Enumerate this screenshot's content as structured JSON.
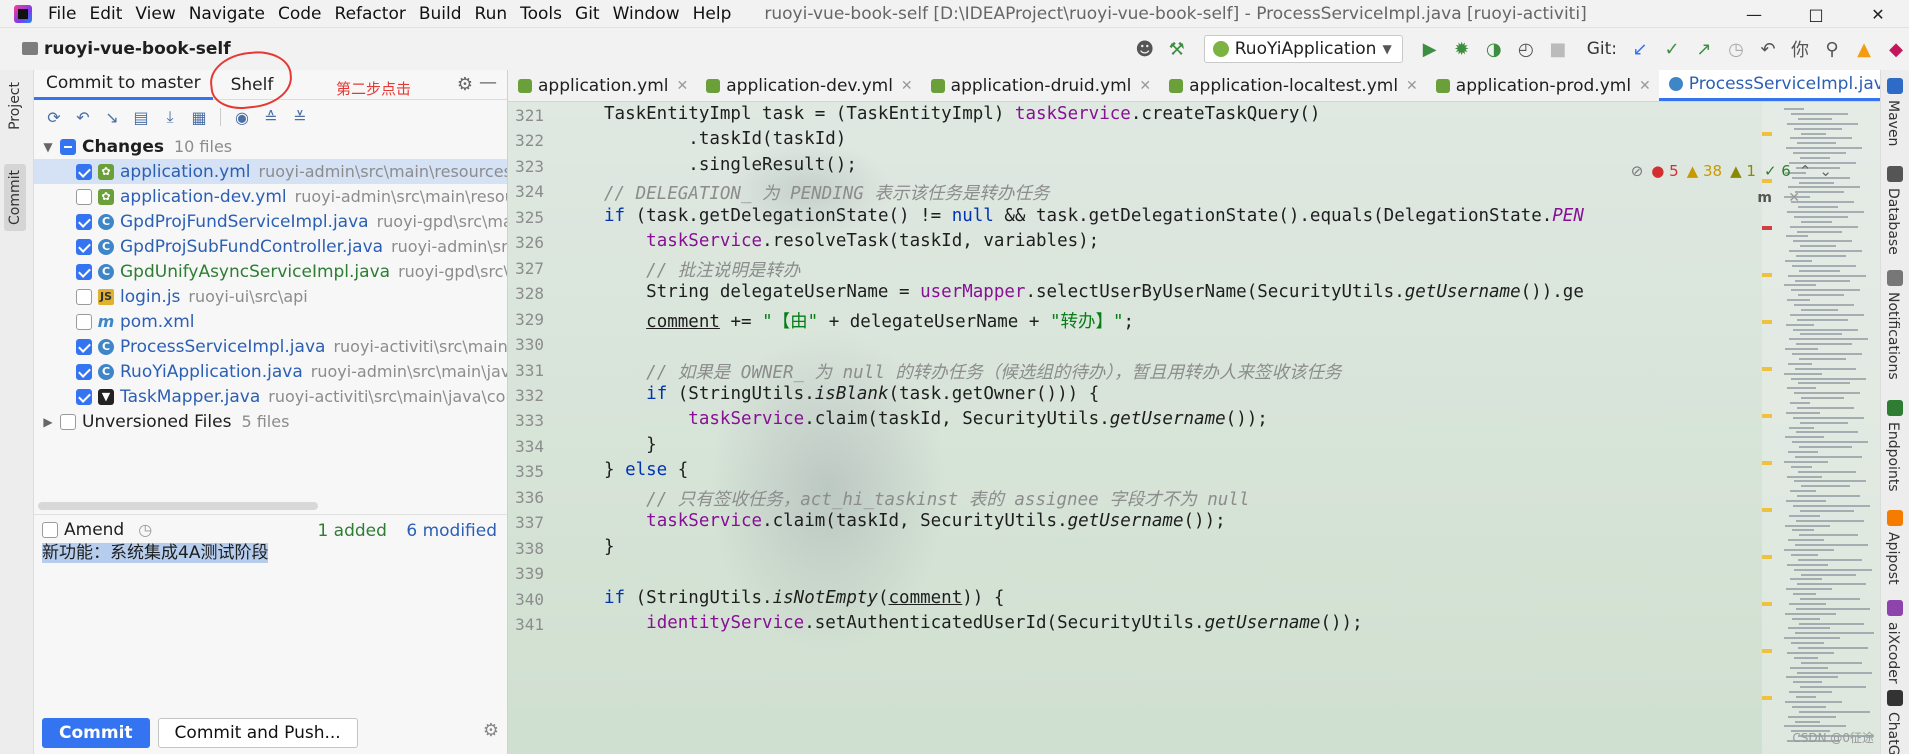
{
  "menu": {
    "items": [
      "File",
      "Edit",
      "View",
      "Navigate",
      "Code",
      "Refactor",
      "Build",
      "Run",
      "Tools",
      "Git",
      "Window",
      "Help"
    ],
    "window_title": "ruoyi-vue-book-self [D:\\IDEAProject\\ruoyi-vue-book-self] - ProcessServiceImpl.java [ruoyi-activiti]"
  },
  "toolbar": {
    "project_name": "ruoyi-vue-book-self",
    "run_config": "RuoYiApplication",
    "git_label": "Git:"
  },
  "left_strip": {
    "project_tab": "Project",
    "commit_tab": "Commit"
  },
  "commit_panel": {
    "tabs": {
      "commit": "Commit to master",
      "shelf": "Shelf"
    },
    "annotation_text": "第二步点击",
    "changes_group": {
      "label": "Changes",
      "count": "10 files"
    },
    "files": [
      {
        "name": "application.yml",
        "path": "ruoyi-admin\\src\\main\\resources",
        "type": "yml",
        "status": "mod",
        "checked": true,
        "selected": true
      },
      {
        "name": "application-dev.yml",
        "path": "ruoyi-admin\\src\\main\\resou",
        "type": "yml",
        "status": "mod",
        "checked": false,
        "selected": false
      },
      {
        "name": "GpdProjFundServiceImpl.java",
        "path": "ruoyi-gpd\\src\\main",
        "type": "java",
        "status": "mod",
        "checked": true,
        "selected": false
      },
      {
        "name": "GpdProjSubFundController.java",
        "path": "ruoyi-admin\\src\\",
        "type": "java",
        "status": "mod",
        "checked": true,
        "selected": false
      },
      {
        "name": "GpdUnifyAsyncServiceImpl.java",
        "path": "ruoyi-gpd\\src\\ma",
        "type": "java",
        "status": "add",
        "checked": true,
        "selected": false
      },
      {
        "name": "login.js",
        "path": "ruoyi-ui\\src\\api",
        "type": "js",
        "status": "mod",
        "checked": false,
        "selected": false
      },
      {
        "name": "pom.xml",
        "path": "",
        "type": "xml",
        "status": "mod",
        "checked": false,
        "selected": false
      },
      {
        "name": "ProcessServiceImpl.java",
        "path": "ruoyi-activiti\\src\\main\\ja",
        "type": "java",
        "status": "mod",
        "checked": true,
        "selected": false
      },
      {
        "name": "RuoYiApplication.java",
        "path": "ruoyi-admin\\src\\main\\java",
        "type": "java",
        "status": "mod",
        "checked": true,
        "selected": false
      },
      {
        "name": "TaskMapper.java",
        "path": "ruoyi-activiti\\src\\main\\java\\con",
        "type": "mapper",
        "status": "mod",
        "checked": true,
        "selected": false
      }
    ],
    "unversioned_group": {
      "label": "Unversioned Files",
      "count": "5 files"
    },
    "amend_label": "Amend",
    "stats": {
      "added": "1 added",
      "modified": "6 modified"
    },
    "commit_message": "新功能：系统集成4A测试阶段",
    "buttons": {
      "commit": "Commit",
      "commit_push": "Commit and Push..."
    }
  },
  "editor": {
    "tabs": [
      {
        "label": "application.yml",
        "type": "yml",
        "active": false
      },
      {
        "label": "application-dev.yml",
        "type": "yml",
        "active": false
      },
      {
        "label": "application-druid.yml",
        "type": "yml",
        "active": false
      },
      {
        "label": "application-localtest.yml",
        "type": "yml",
        "active": false
      },
      {
        "label": "application-prod.yml",
        "type": "yml",
        "active": false
      },
      {
        "label": "ProcessServiceImpl.java",
        "type": "java",
        "active": true
      }
    ],
    "inspections": {
      "errors": "5",
      "warnings": "38",
      "weak": "1",
      "ok": "6"
    },
    "ai_badge": "m",
    "line_numbers": [
      "321",
      "322",
      "323",
      "324",
      "325",
      "326",
      "327",
      "328",
      "329",
      "330",
      "331",
      "332",
      "333",
      "334",
      "335",
      "336",
      "337",
      "338",
      "339",
      "340",
      "341"
    ],
    "code_lines": [
      [
        [
          "",
          "TaskEntityImpl task = (TaskEntityImpl) "
        ],
        [
          "fld",
          "taskService"
        ],
        [
          "",
          ".createTaskQuery()"
        ]
      ],
      [
        [
          "",
          "        .taskId(taskId)"
        ]
      ],
      [
        [
          "",
          "        .singleResult();"
        ]
      ],
      [
        [
          "cm",
          "// DELEGATION_ 为 PENDING 表示该任务是转办任务"
        ]
      ],
      [
        [
          "kw",
          "if"
        ],
        [
          "",
          " (task.getDelegationState() != "
        ],
        [
          "kw",
          "null"
        ],
        [
          "",
          " && task.getDelegationState().equals(DelegationState."
        ],
        [
          "fld it",
          "PEN"
        ]
      ],
      [
        [
          "",
          "    "
        ],
        [
          "fld",
          "taskService"
        ],
        [
          "",
          ".resolveTask(taskId, variables);"
        ]
      ],
      [
        [
          "",
          "    "
        ],
        [
          "cm",
          "// 批注说明是转办"
        ]
      ],
      [
        [
          "",
          "    String delegateUserName = "
        ],
        [
          "fld",
          "userMapper"
        ],
        [
          "",
          ".selectUserByUserName(SecurityUtils."
        ],
        [
          "it",
          "getUsername"
        ],
        [
          "",
          "()).ge"
        ]
      ],
      [
        [
          "",
          "    "
        ],
        [
          "ul",
          "comment"
        ],
        [
          "",
          " += "
        ],
        [
          "str",
          "\"【由\""
        ],
        [
          "",
          " + delegateUserName + "
        ],
        [
          "str",
          "\"转办】\""
        ],
        [
          "",
          ";"
        ]
      ],
      [
        [
          "",
          ""
        ]
      ],
      [
        [
          "",
          "    "
        ],
        [
          "cm",
          "// 如果是 OWNER_ 为 null 的转办任务（候选组的待办），暂且用转办人来签收该任务"
        ]
      ],
      [
        [
          "",
          "    "
        ],
        [
          "kw",
          "if"
        ],
        [
          "",
          " (StringUtils."
        ],
        [
          "it",
          "isBlank"
        ],
        [
          "",
          "(task.getOwner())) {"
        ]
      ],
      [
        [
          "",
          "        "
        ],
        [
          "fld",
          "taskService"
        ],
        [
          "",
          ".claim(taskId, SecurityUtils."
        ],
        [
          "it",
          "getUsername"
        ],
        [
          "",
          "());"
        ]
      ],
      [
        [
          "",
          "    }"
        ]
      ],
      [
        [
          "",
          "} "
        ],
        [
          "kw",
          "else"
        ],
        [
          "",
          " {"
        ]
      ],
      [
        [
          "",
          "    "
        ],
        [
          "cm",
          "// 只有签收任务，act_hi_taskinst 表的 assignee 字段才不为 null"
        ]
      ],
      [
        [
          "",
          "    "
        ],
        [
          "fld",
          "taskService"
        ],
        [
          "",
          ".claim(taskId, SecurityUtils."
        ],
        [
          "it",
          "getUsername"
        ],
        [
          "",
          "());"
        ]
      ],
      [
        [
          "",
          "}"
        ]
      ],
      [
        [
          "",
          ""
        ]
      ],
      [
        [
          "kw",
          "if"
        ],
        [
          "",
          " (StringUtils."
        ],
        [
          "it",
          "isNotEmpty"
        ],
        [
          "",
          "("
        ],
        [
          "ul",
          "comment"
        ],
        [
          "",
          ")) {"
        ]
      ],
      [
        [
          "",
          "    "
        ],
        [
          "fld",
          "identityService"
        ],
        [
          "",
          ".setAuthenticatedUserId(SecurityUtils."
        ],
        [
          "it",
          "getUsername"
        ],
        [
          "",
          "());"
        ]
      ]
    ]
  },
  "right_strip": {
    "tabs": [
      "Maven",
      "Database",
      "Notifications",
      "Endpoints",
      "Apipost",
      "aiXcoder",
      "ChatGPT"
    ]
  },
  "watermark": "CSDN @0征途",
  "colors": {
    "accent": "#3574f0",
    "annotation": "#e53935",
    "keyword": "#0033b3",
    "field": "#871094",
    "string": "#067d17",
    "comment": "#8c8c8c"
  }
}
